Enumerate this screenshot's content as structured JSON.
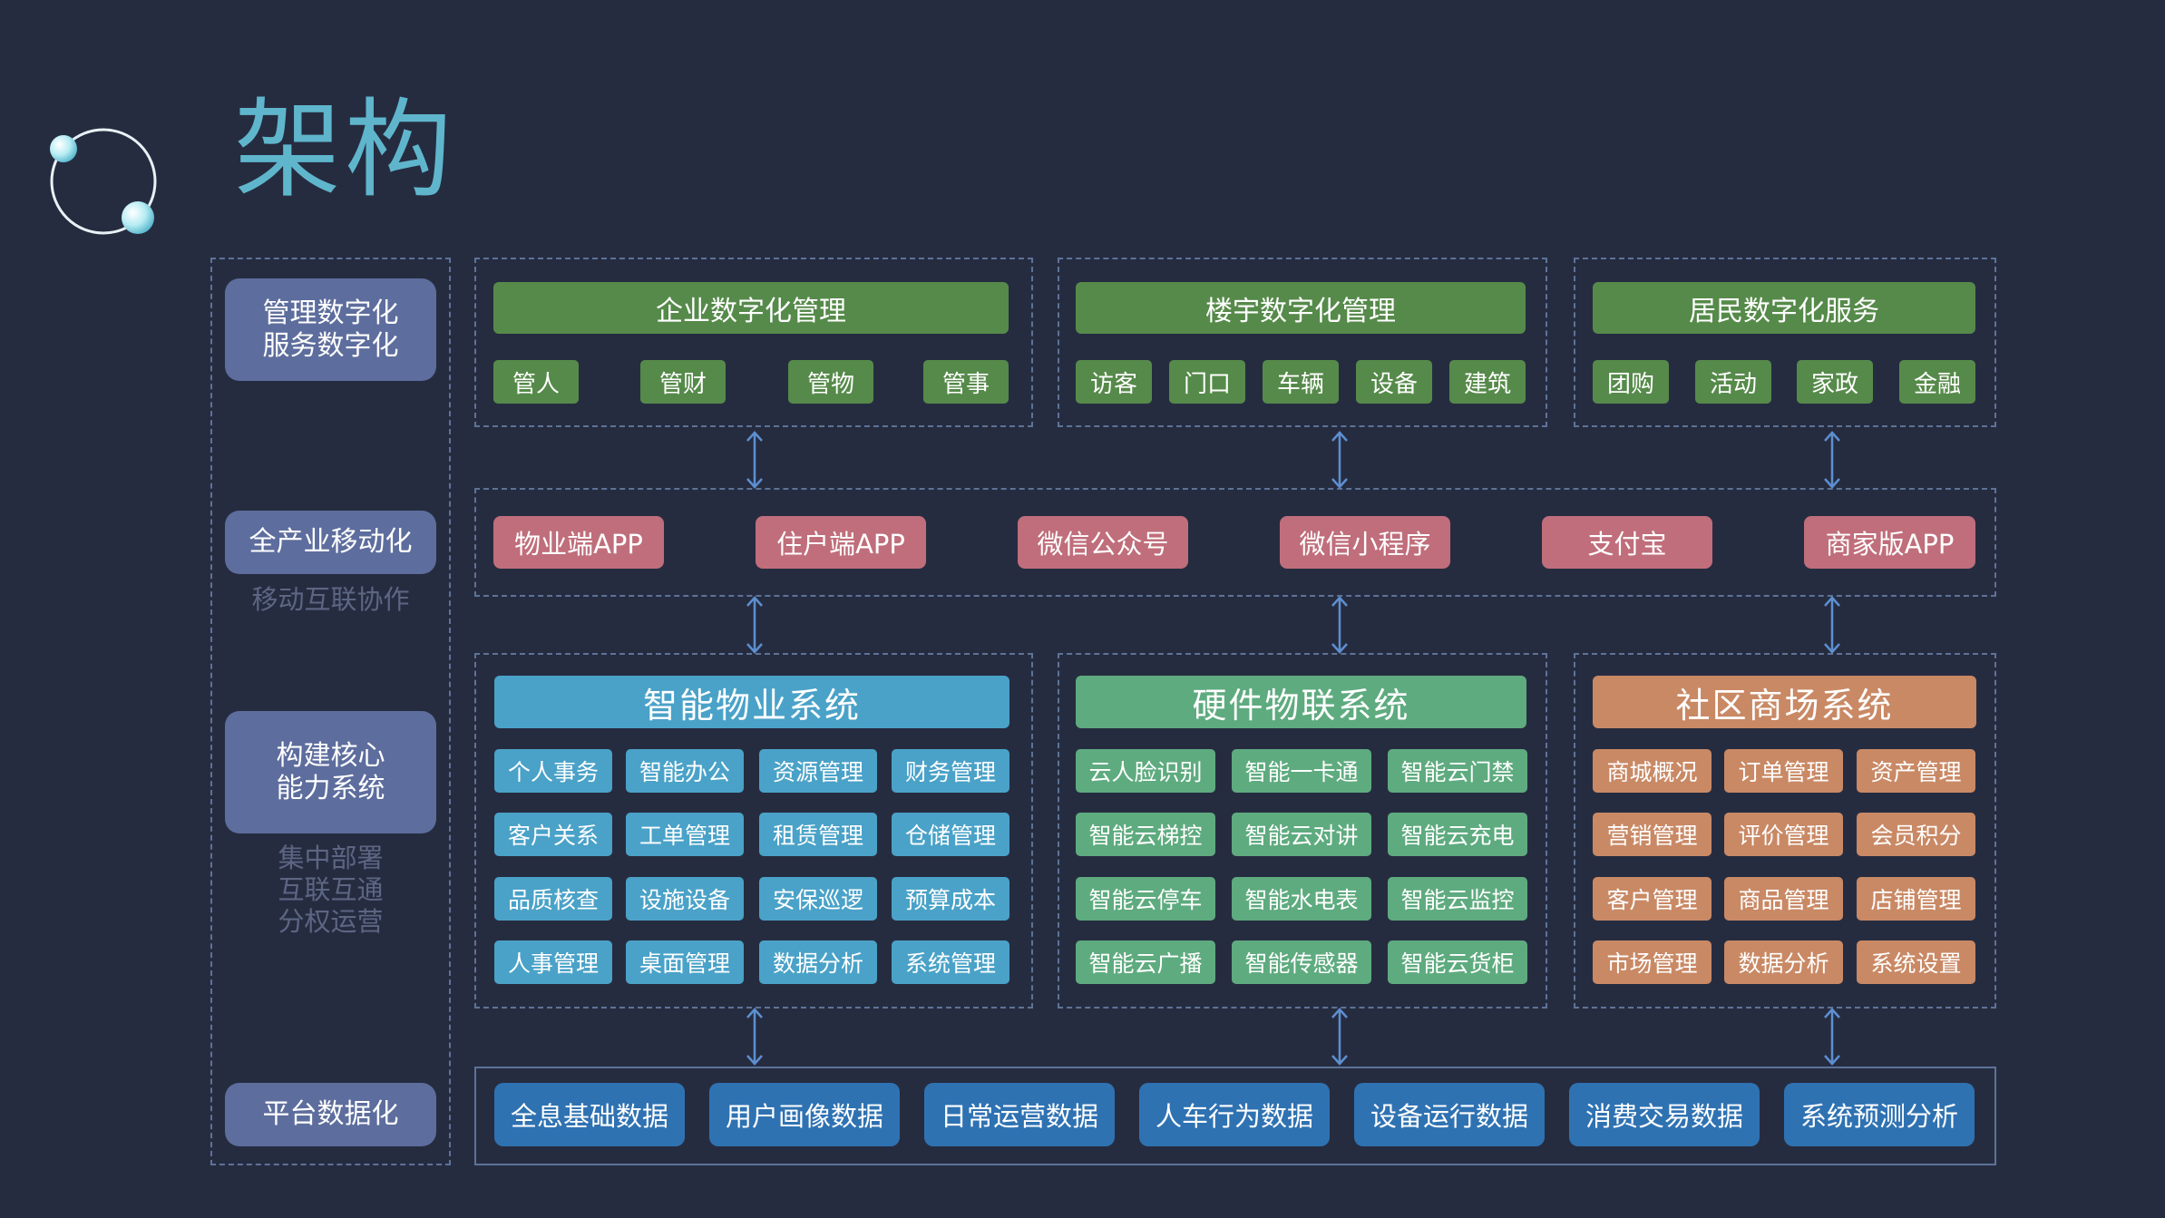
{
  "title": "架构",
  "colors": {
    "background": "#262c40",
    "accent_title": "#5fb6cc",
    "green": "#568a4a",
    "pink": "#c06e7b",
    "blue": "#4aa2c8",
    "teal": "#5eab7f",
    "orange": "#c98965",
    "data_blue": "#2f72b2",
    "side_label": "#5d6d9d"
  },
  "left_column": {
    "management": "管理数字化\n服务数字化",
    "mobile": "全产业移动化",
    "mobile_sub": "移动互联协作",
    "core": "构建核心\n能力系统",
    "core_sub": "集中部署\n互联互通\n分权运营",
    "platform": "平台数据化"
  },
  "top_groups": [
    {
      "title": "企业数字化管理",
      "tags": [
        "管人",
        "管财",
        "管物",
        "管事"
      ]
    },
    {
      "title": "楼宇数字化管理",
      "tags": [
        "访客",
        "门口",
        "车辆",
        "设备",
        "建筑"
      ]
    },
    {
      "title": "居民数字化服务",
      "tags": [
        "团购",
        "活动",
        "家政",
        "金融"
      ]
    }
  ],
  "apps": [
    "物业端APP",
    "住户端APP",
    "微信公众号",
    "微信小程序",
    "支付宝",
    "商家版APP"
  ],
  "systems": [
    {
      "title": "智能物业系统",
      "items": [
        "个人事务",
        "智能办公",
        "资源管理",
        "财务管理",
        "客户关系",
        "工单管理",
        "租赁管理",
        "仓储管理",
        "品质核查",
        "设施设备",
        "安保巡逻",
        "预算成本",
        "人事管理",
        "桌面管理",
        "数据分析",
        "系统管理"
      ]
    },
    {
      "title": "硬件物联系统",
      "items": [
        "云人脸识别",
        "智能一卡通",
        "智能云门禁",
        "智能云梯控",
        "智能云对讲",
        "智能云充电",
        "智能云停车",
        "智能水电表",
        "智能云监控",
        "智能云广播",
        "智能传感器",
        "智能云货柜"
      ]
    },
    {
      "title": "社区商场系统",
      "items": [
        "商城概况",
        "订单管理",
        "资产管理",
        "营销管理",
        "评价管理",
        "会员积分",
        "客户管理",
        "商品管理",
        "店铺管理",
        "市场管理",
        "数据分析",
        "系统设置"
      ]
    }
  ],
  "data_layer": [
    "全息基础数据",
    "用户画像数据",
    "日常运营数据",
    "人车行为数据",
    "设备运行数据",
    "消费交易数据",
    "系统预测分析"
  ]
}
